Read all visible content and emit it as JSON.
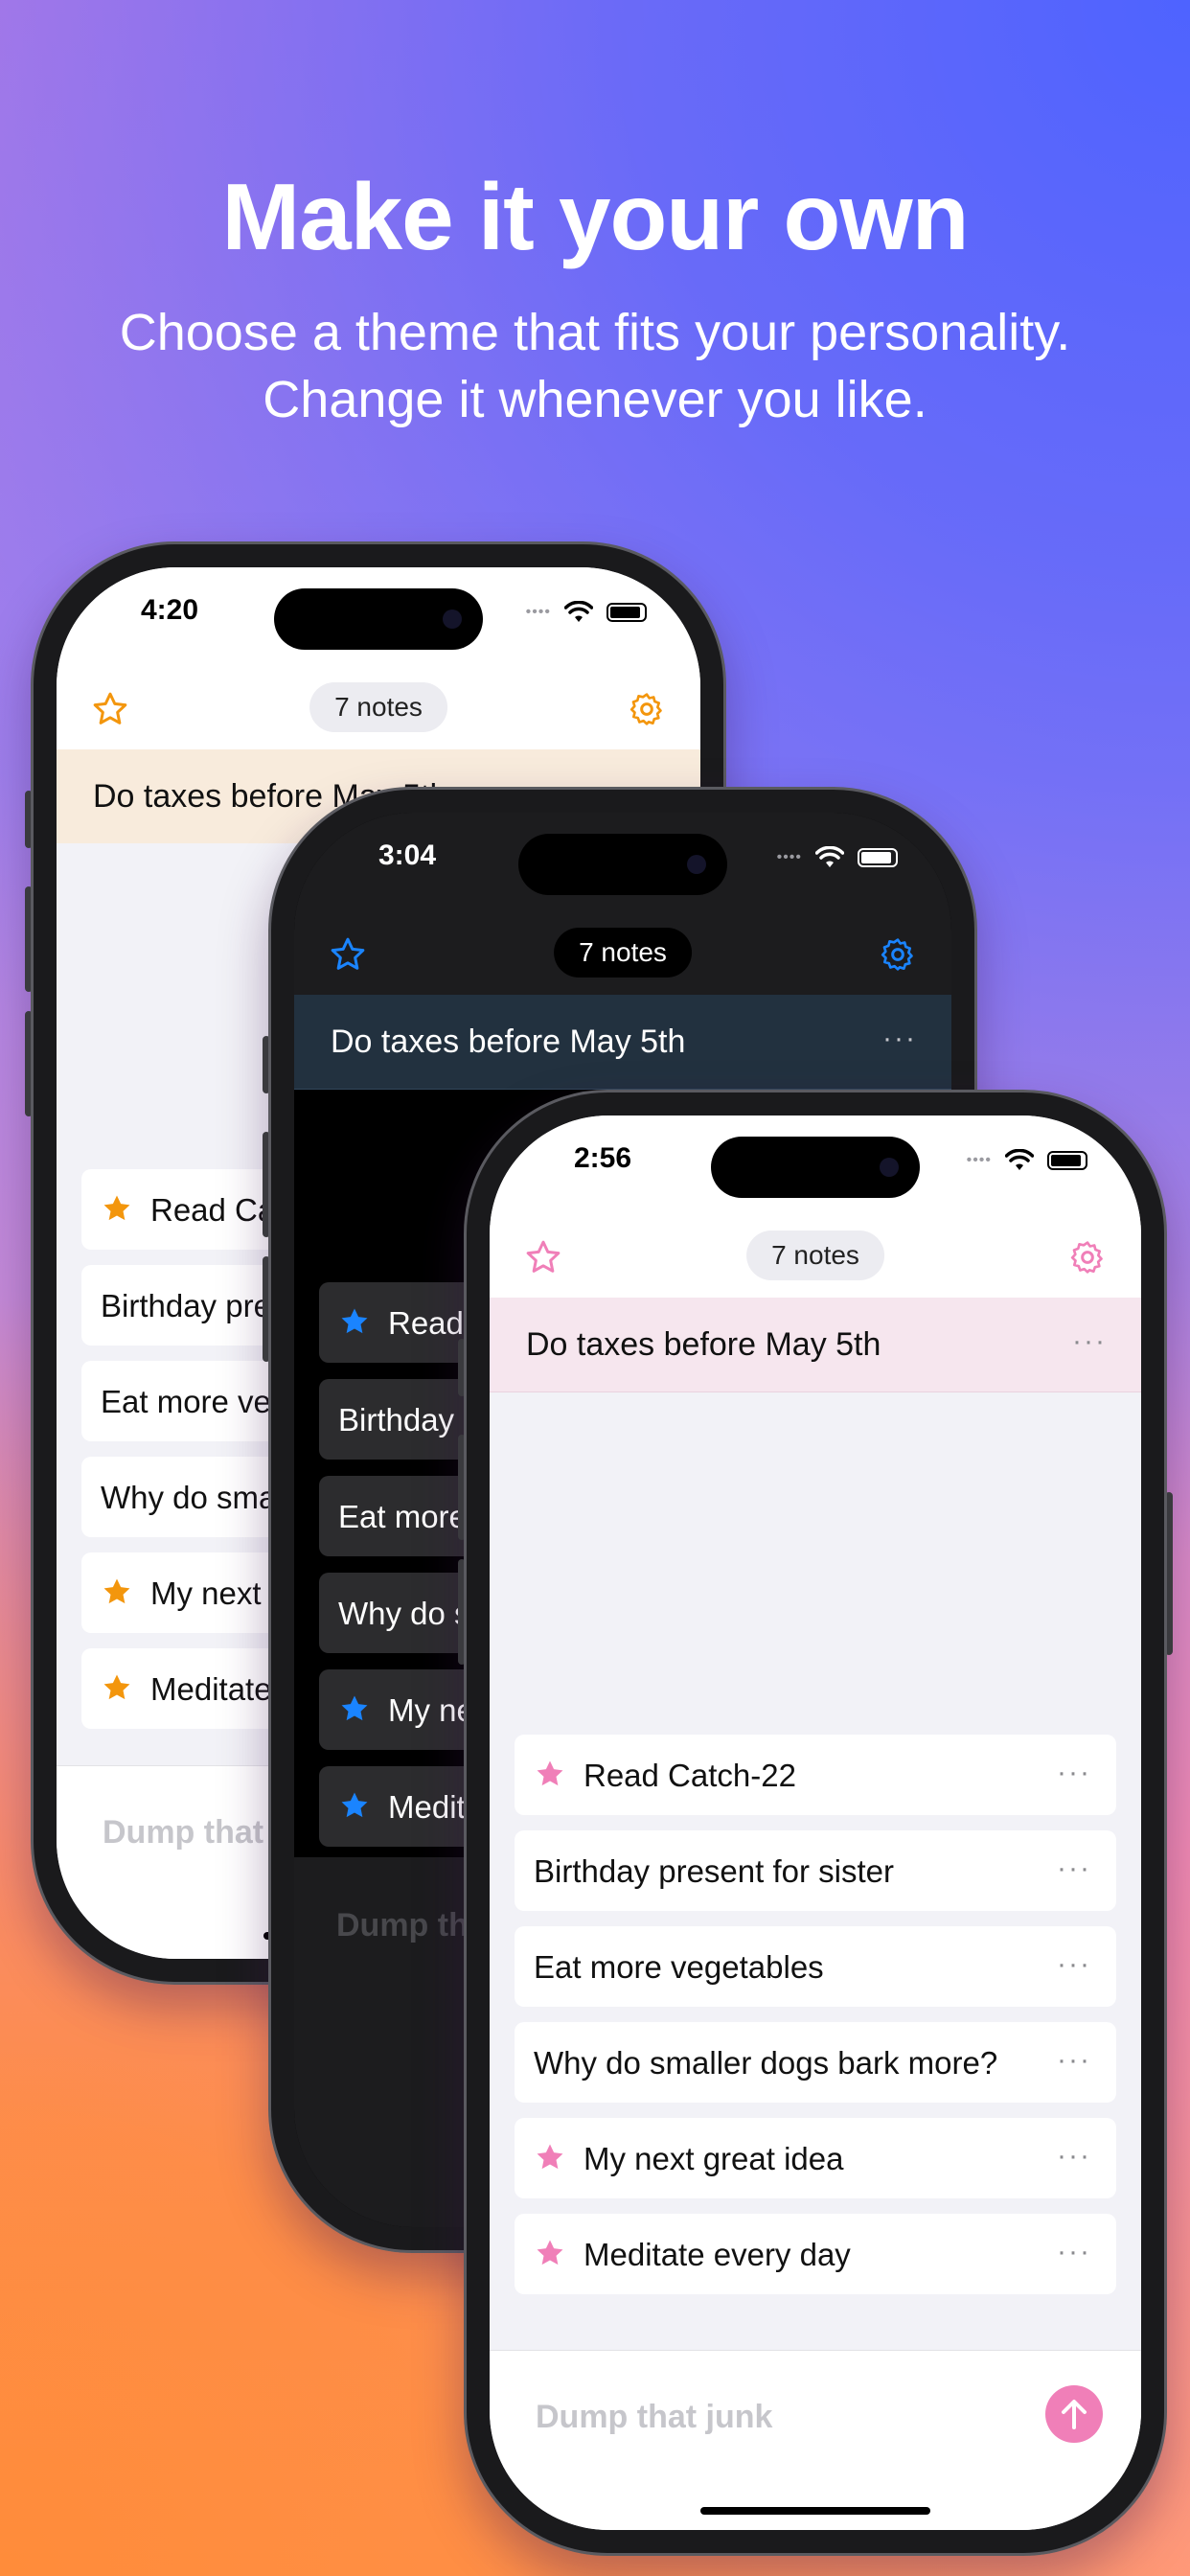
{
  "hero": {
    "title": "Make it your own",
    "subtitle_line1": "Choose a theme that fits your personality.",
    "subtitle_line2": "Change it whenever you like."
  },
  "colors": {
    "orange_accent": "#F3960D",
    "blue_accent": "#1A84FF",
    "pink_accent": "#F07FB8",
    "light_pinned_orange": "#F8EBDC",
    "dark_pinned_navy": "#22313F",
    "light_pinned_pink": "#F6E6EE"
  },
  "phones": [
    {
      "theme": "light-orange",
      "time": "4:20",
      "notes_count": "7 notes",
      "pinned_note": "Do taxes before May 5th",
      "notes": [
        {
          "label": "Read Catch-22",
          "starred": true
        },
        {
          "label": "Birthday present for sister",
          "starred": false
        },
        {
          "label": "Eat more vegetables",
          "starred": false
        },
        {
          "label": "Why do smaller dogs bark more?",
          "starred": false
        },
        {
          "label": "My next great idea",
          "starred": true
        },
        {
          "label": "Meditate every day",
          "starred": true
        }
      ],
      "compose_placeholder": "Dump that junk"
    },
    {
      "theme": "dark-blue",
      "time": "3:04",
      "notes_count": "7 notes",
      "pinned_note": "Do taxes before May 5th",
      "notes": [
        {
          "label": "Read Catch-22",
          "starred": true
        },
        {
          "label": "Birthday present for sister",
          "starred": false
        },
        {
          "label": "Eat more vegetables",
          "starred": false
        },
        {
          "label": "Why do smaller dogs bark more?",
          "starred": false
        },
        {
          "label": "My next great idea",
          "starred": true
        },
        {
          "label": "Meditate every day",
          "starred": true
        }
      ],
      "compose_placeholder": "Dump that junk"
    },
    {
      "theme": "light-pink",
      "time": "2:56",
      "notes_count": "7 notes",
      "pinned_note": "Do taxes before May 5th",
      "notes": [
        {
          "label": "Read Catch-22",
          "starred": true
        },
        {
          "label": "Birthday present for sister",
          "starred": false
        },
        {
          "label": "Eat more vegetables",
          "starred": false
        },
        {
          "label": "Why do smaller dogs bark more?",
          "starred": false
        },
        {
          "label": "My next great idea",
          "starred": true
        },
        {
          "label": "Meditate every day",
          "starred": true
        }
      ],
      "compose_placeholder": "Dump that junk"
    }
  ]
}
